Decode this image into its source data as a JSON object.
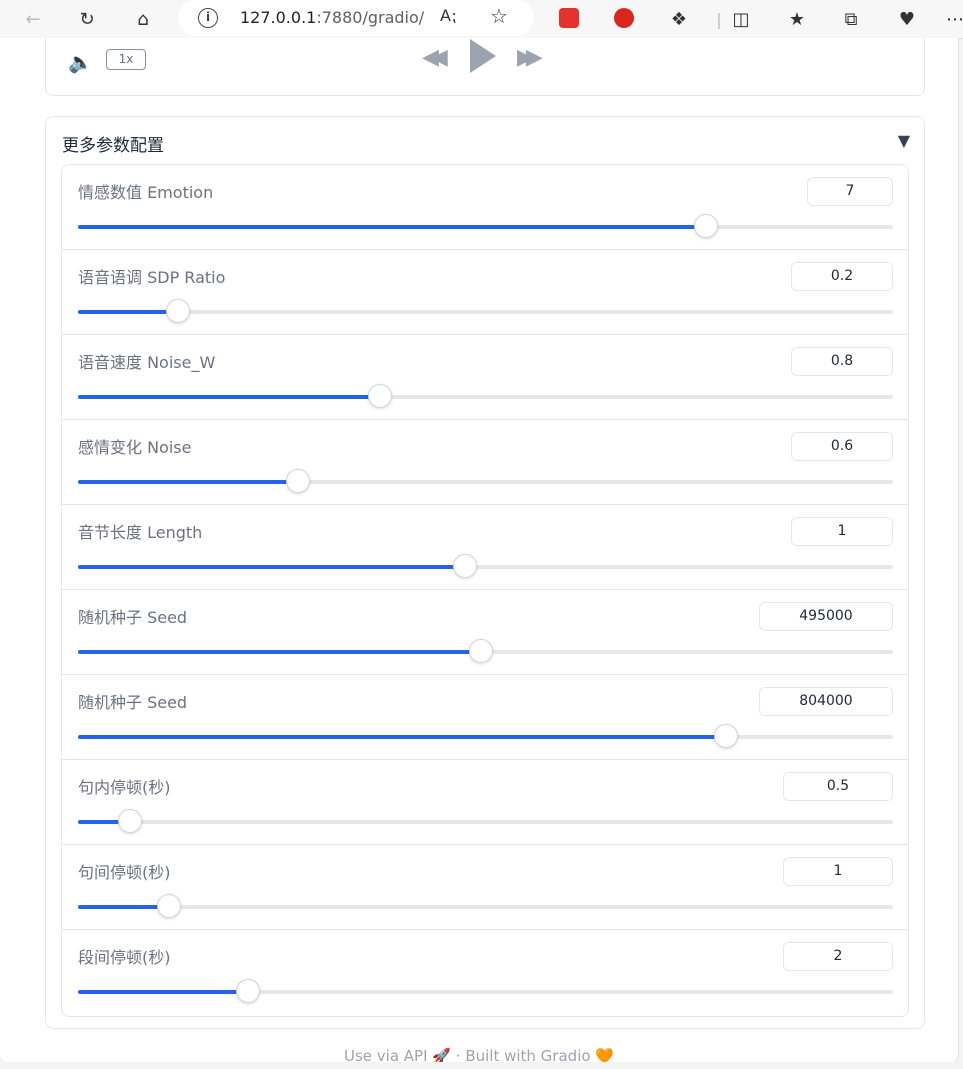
{
  "browser": {
    "url_host": "127.0.0.1",
    "url_rest": ":7880/gradio/",
    "read_aloud_icon": "read-aloud-icon",
    "favorite_icon": "star-icon"
  },
  "audio_player": {
    "speed_label": "1x"
  },
  "accordion": {
    "title": "更多参数配置",
    "toggle_glyph": "▼"
  },
  "params": [
    {
      "label": "情感数值 Emotion",
      "value": "7",
      "fraction": 0.77
    },
    {
      "label": "语音语调 SDP Ratio",
      "value": "0.2",
      "fraction": 0.123
    },
    {
      "label": "语音速度 Noise_W",
      "value": "0.8",
      "fraction": 0.371
    },
    {
      "label": "感情变化 Noise",
      "value": "0.6",
      "fraction": 0.27
    },
    {
      "label": "音节长度 Length",
      "value": "1",
      "fraction": 0.475
    },
    {
      "label": "随机种子 Seed",
      "value": "495000",
      "fraction": 0.495
    },
    {
      "label": "随机种子 Seed",
      "value": "804000",
      "fraction": 0.795
    },
    {
      "label": "句内停顿(秒)",
      "value": "0.5",
      "fraction": 0.064
    },
    {
      "label": "句间停顿(秒)",
      "value": "1",
      "fraction": 0.112
    },
    {
      "label": "段间停顿(秒)",
      "value": "2",
      "fraction": 0.208
    }
  ],
  "footer": {
    "api_link": "Use via API",
    "separator": "·",
    "built_with": "Built with Gradio"
  }
}
